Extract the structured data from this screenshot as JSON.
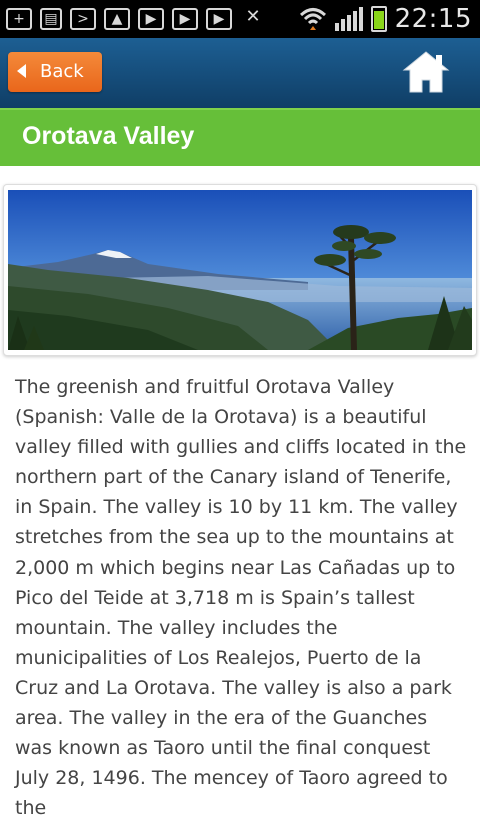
{
  "status_bar": {
    "time": "22:15",
    "icons": [
      "add-icon",
      "sd-card-icon",
      "terminal-icon",
      "gallery-icon",
      "play-icon",
      "play-store-icon",
      "play-icon",
      "no-sim-icon",
      "wifi-icon",
      "signal-icon",
      "battery-icon"
    ]
  },
  "header": {
    "back_label": "Back",
    "home_icon": "home-icon"
  },
  "page": {
    "title": "Orotava Valley"
  },
  "article": {
    "text": "The greenish and fruitful Orotava Valley (Spanish: Valle de la Orotava) is a beautiful valley filled with gullies and cliffs located in the northern part of the Canary island of Tenerife, in Spain. The valley is 10 by 11 km. The valley stretches from the sea up to the mountains at 2,000 m which begins near Las Cañadas up to Pico del Teide at 3,718 m is Spain’s tallest mountain. The valley includes the municipalities of Los Realejos, Puerto de la Cruz and La Orotava. The valley is also a park area. The valley in the era of the Guanches was known as Taoro until the final conquest July 28, 1496. The mencey of Taoro agreed to the"
  },
  "colors": {
    "header": "#1d5f93",
    "back_button": "#f0782a",
    "title_bar": "#66bf39"
  }
}
